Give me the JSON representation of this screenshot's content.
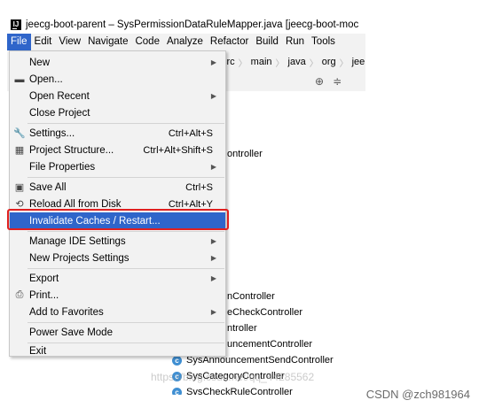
{
  "window": {
    "title": "jeecg-boot-parent – SysPermissionDataRuleMapper.java [jeecg-boot-moc"
  },
  "menubar": [
    {
      "label": "File"
    },
    {
      "label": "Edit"
    },
    {
      "label": "View"
    },
    {
      "label": "Navigate"
    },
    {
      "label": "Code"
    },
    {
      "label": "Analyze"
    },
    {
      "label": "Refactor"
    },
    {
      "label": "Build"
    },
    {
      "label": "Run"
    },
    {
      "label": "Tools"
    }
  ],
  "breadcrumb": [
    "src",
    "main",
    "java",
    "org",
    "jee"
  ],
  "file_menu": {
    "new": "New",
    "open": "Open...",
    "open_recent": "Open Recent",
    "close_project": "Close Project",
    "settings": "Settings...",
    "settings_shortcut": "Ctrl+Alt+S",
    "project_structure": "Project Structure...",
    "project_structure_shortcut": "Ctrl+Alt+Shift+S",
    "file_properties": "File Properties",
    "save_all": "Save All",
    "save_all_shortcut": "Ctrl+S",
    "reload": "Reload All from Disk",
    "reload_shortcut": "Ctrl+Alt+Y",
    "invalidate": "Invalidate Caches / Restart...",
    "manage_ide": "Manage IDE Settings",
    "new_projects": "New Projects Settings",
    "export": "Export",
    "print": "Print...",
    "favorites": "Add to Favorites",
    "power_save": "Power Save Mode",
    "exit": "Exit"
  },
  "tree": {
    "fragments": [
      "ontroller",
      "nController",
      "eCheckController",
      "ntroller",
      "uncementController"
    ],
    "classes": [
      "SysAnnouncementSendController",
      "SysCategoryController",
      "SysCheckRuleController"
    ]
  },
  "watermark": "https://blog.csdn.net/qq_44285562",
  "csdn_credit": "CSDN @zch981964",
  "colors": {
    "selection": "#2f65ca",
    "highlight_border": "#e02020",
    "class_icon": "#3f8fd2"
  }
}
